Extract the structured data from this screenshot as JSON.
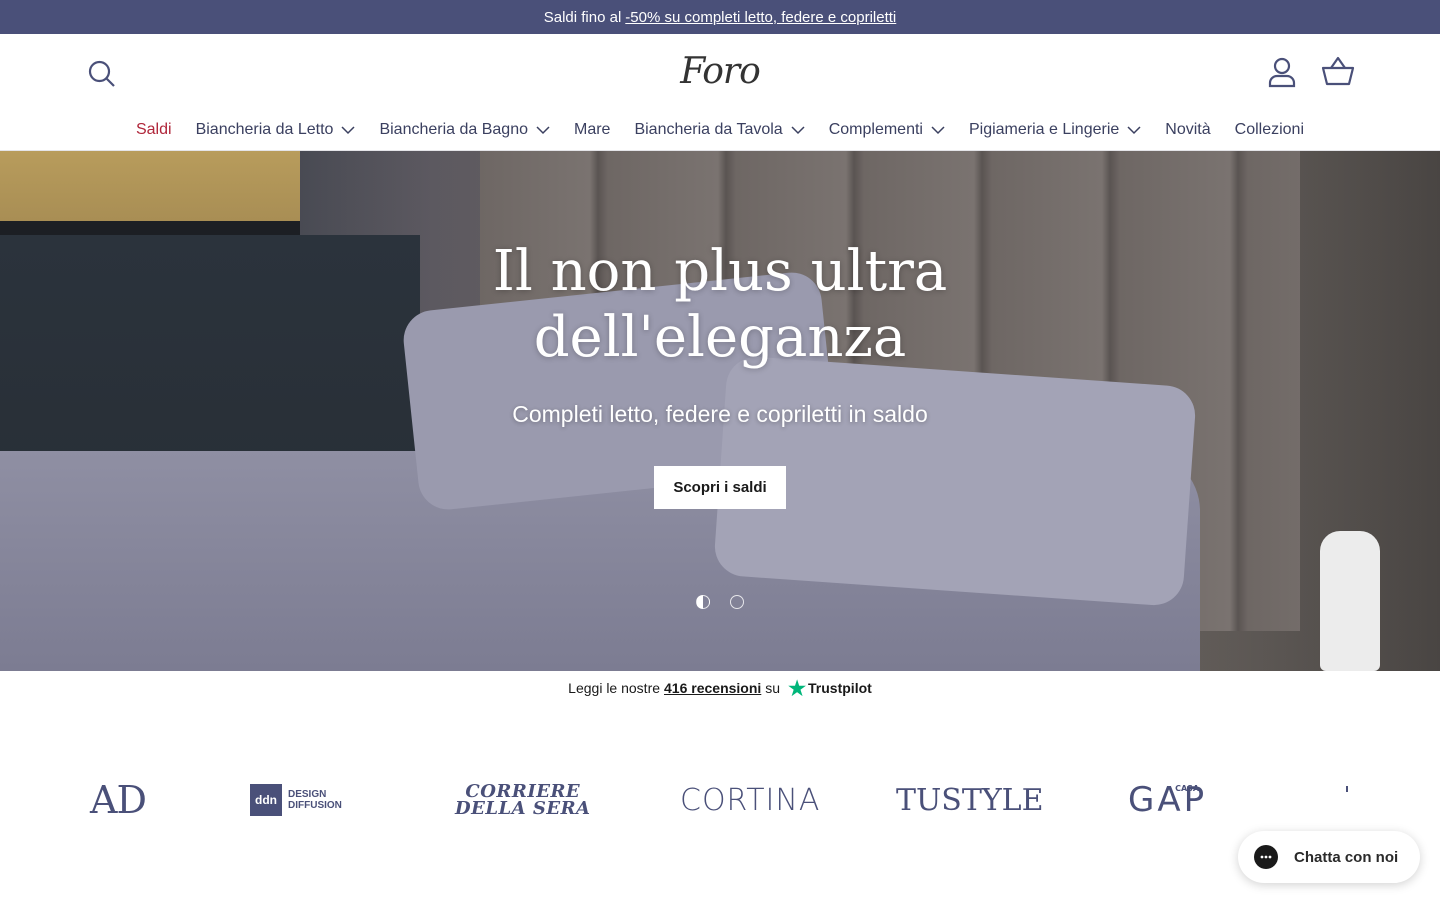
{
  "announcement": {
    "prefix": "Saldi fino al",
    "link": "-50% su completi letto, federe e copriletti"
  },
  "header": {
    "logo_text": "Foro",
    "icons": {
      "search": "search-icon",
      "account": "account-icon",
      "cart": "basket-icon"
    }
  },
  "nav": {
    "items": [
      {
        "label": "Saldi",
        "dropdown": false,
        "highlight": "#b0263a"
      },
      {
        "label": "Biancheria da Letto",
        "dropdown": true
      },
      {
        "label": "Biancheria da Bagno",
        "dropdown": true
      },
      {
        "label": "Mare",
        "dropdown": false
      },
      {
        "label": "Biancheria da Tavola",
        "dropdown": true
      },
      {
        "label": "Complementi",
        "dropdown": true
      },
      {
        "label": "Pigiameria e Lingerie",
        "dropdown": true
      },
      {
        "label": "Novità",
        "dropdown": false
      },
      {
        "label": "Collezioni",
        "dropdown": false
      }
    ]
  },
  "hero": {
    "title_line1": "Il non plus ultra",
    "title_line2": "dell'eleganza",
    "subtitle": "Completi letto, federe e copriletti in saldo",
    "cta": "Scopri i saldi",
    "slides_total": 2,
    "active_slide": 1
  },
  "trustpilot": {
    "prefix": "Leggi le nostre",
    "link": "416 recensioni",
    "suffix": "su",
    "brand": "Trustpilot"
  },
  "press": {
    "ad": "AD",
    "ddn_box": "ddn",
    "ddn_line1": "DESIGN",
    "ddn_line2": "DIFFUSION",
    "corriere_line1": "CORRIERE",
    "corriere_line2": "DELLA SERA",
    "cortina": "CORTINA",
    "tustyle": "TUSTYLE",
    "gap": "GAP",
    "gap_casa": "CASA"
  },
  "chat": {
    "label": "Chatta con noi"
  },
  "colors": {
    "announcement_bg": "#4a5079",
    "sale_red": "#b0263a",
    "trustpilot_green": "#00b67a"
  }
}
